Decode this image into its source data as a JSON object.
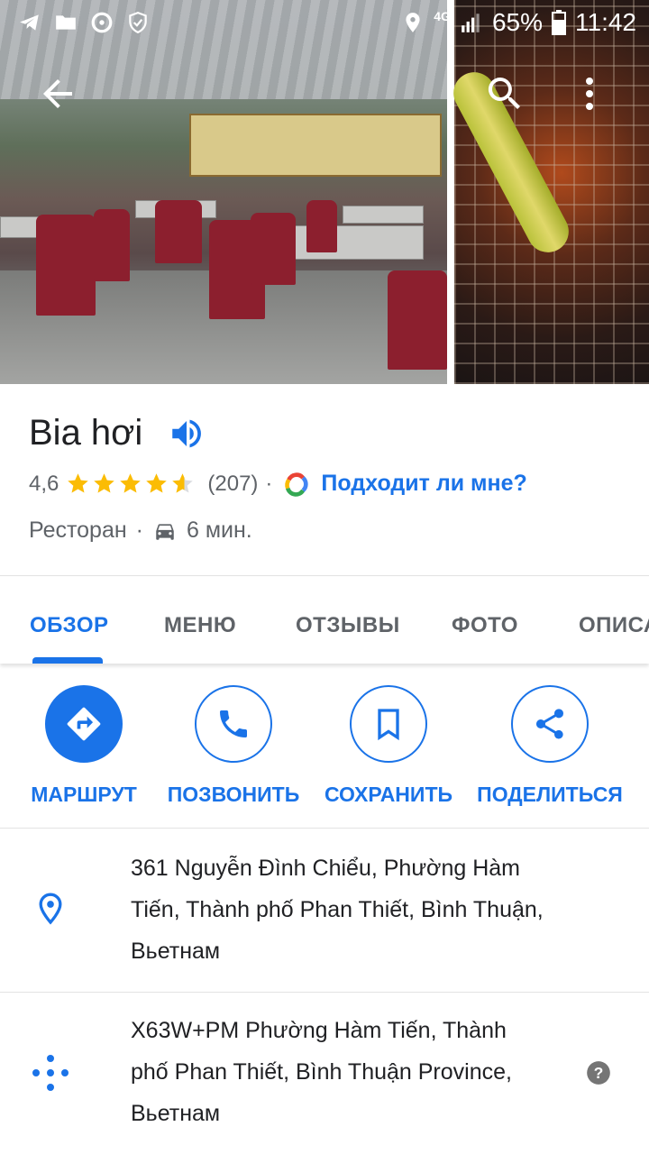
{
  "status_bar": {
    "network": "4G",
    "battery": "65%",
    "time": "11:42"
  },
  "place": {
    "name": "Bia hơi",
    "rating": "4,6",
    "rating_value": 4.6,
    "reviews_count": "(207)",
    "separator": "·",
    "fit_link": "Подходит ли мне?",
    "category": "Ресторан",
    "drive_time": "6 мин."
  },
  "tabs": [
    {
      "label": "ОБЗОР",
      "active": true
    },
    {
      "label": "МЕНЮ",
      "active": false
    },
    {
      "label": "ОТЗЫВЫ",
      "active": false
    },
    {
      "label": "ФОТО",
      "active": false
    },
    {
      "label": "ОПИСАНИЕ",
      "active": false
    }
  ],
  "actions": {
    "route": "МАРШРУТ",
    "call": "ПОЗВОНИТЬ",
    "save": "СОХРАНИТЬ",
    "share": "ПОДЕЛИТЬСЯ"
  },
  "address": {
    "line1": "361 Nguyễn Đình Chiểu, Phường Hàm",
    "line2": "Tiến, Thành phố Phan Thiết, Bình Thuận,",
    "line3": "Вьетнам"
  },
  "plus_code": {
    "line1": "X63W+PM Phường Hàm Tiến, Thành",
    "line2": "phố Phan Thiết, Bình Thuận Province,",
    "line3": "Вьетнам"
  },
  "colors": {
    "accent": "#1a73e8",
    "star": "#fbbc04",
    "text_secondary": "#5f6368"
  },
  "icons": [
    "telegram-icon",
    "folder-icon",
    "disc-icon",
    "shield-icon",
    "location-icon",
    "signal-icon",
    "battery-icon",
    "back-arrow-icon",
    "search-icon",
    "more-vert-icon",
    "speaker-icon",
    "star-icon",
    "google-icon",
    "car-icon",
    "directions-icon",
    "phone-icon",
    "bookmark-icon",
    "share-icon",
    "pin-icon",
    "plus-code-icon",
    "help-icon"
  ]
}
